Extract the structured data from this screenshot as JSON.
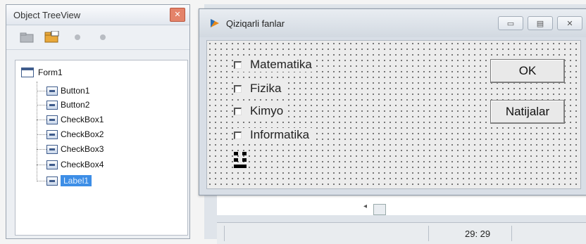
{
  "tree_view": {
    "title": "Object TreeView",
    "close_icon": "close-icon",
    "toolbar_icons": [
      "folder-gray-icon",
      "folder-open-icon",
      "move-up-icon",
      "move-down-icon"
    ],
    "root": "Form1",
    "children": [
      "Button1",
      "Button2",
      "CheckBox1",
      "CheckBox2",
      "CheckBox3",
      "CheckBox4",
      "Label1"
    ],
    "selected": "Label1"
  },
  "form_window": {
    "title": "Qiziqarli fanlar",
    "app_icon": "delphi-app-icon",
    "checkboxes": [
      {
        "label": "Matematika",
        "checked": false
      },
      {
        "label": "Fizika",
        "checked": false
      },
      {
        "label": "Kimyo",
        "checked": false
      },
      {
        "label": "Informatika",
        "checked": false
      }
    ],
    "buttons": {
      "ok": "OK",
      "results": "Natijalar"
    }
  },
  "status_bar": {
    "cursor_position": "29: 29"
  },
  "colors": {
    "selection": "#3d8ee6",
    "close_button": "#e4836a"
  }
}
